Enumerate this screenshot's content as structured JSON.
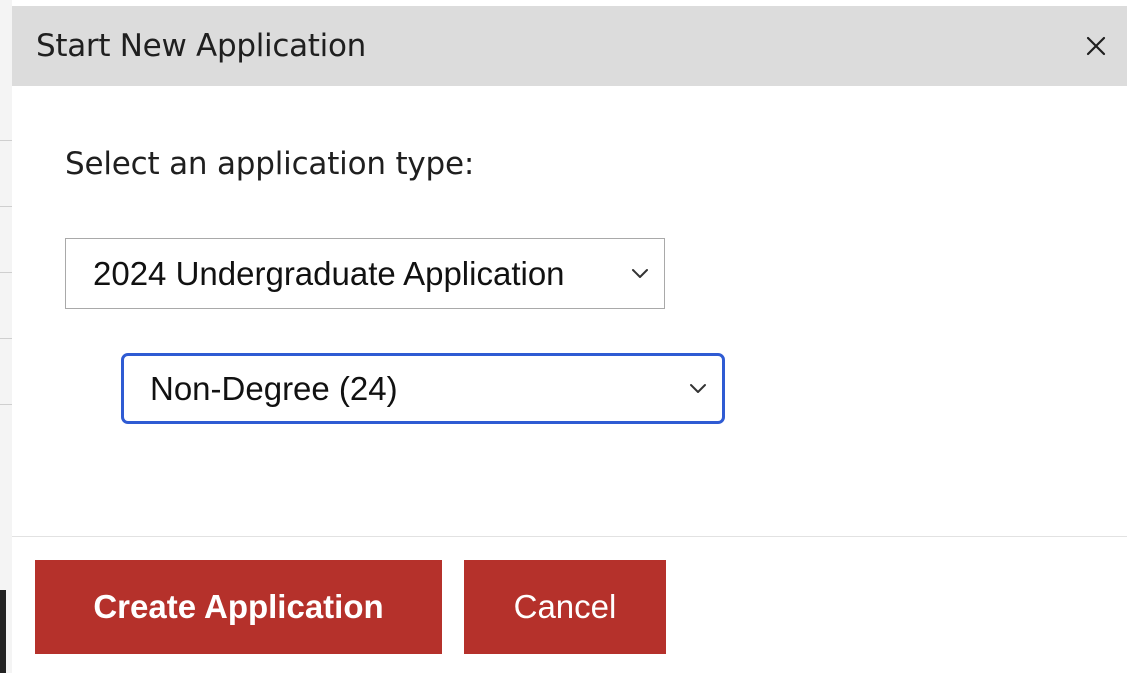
{
  "dialog": {
    "title": "Start New Application",
    "close_icon": "close-icon"
  },
  "form": {
    "prompt": "Select an application type:",
    "application_type": {
      "selected": "2024 Undergraduate Application",
      "icon": "chevron-down-icon"
    },
    "program_type": {
      "selected": "Non-Degree (24)",
      "icon": "chevron-down-icon",
      "focused": true
    }
  },
  "footer": {
    "create_label": "Create Application",
    "cancel_label": "Cancel"
  },
  "colors": {
    "header_bg": "#dcdcdc",
    "primary_button": "#b5312b",
    "focus_ring": "#2f5bd3"
  }
}
